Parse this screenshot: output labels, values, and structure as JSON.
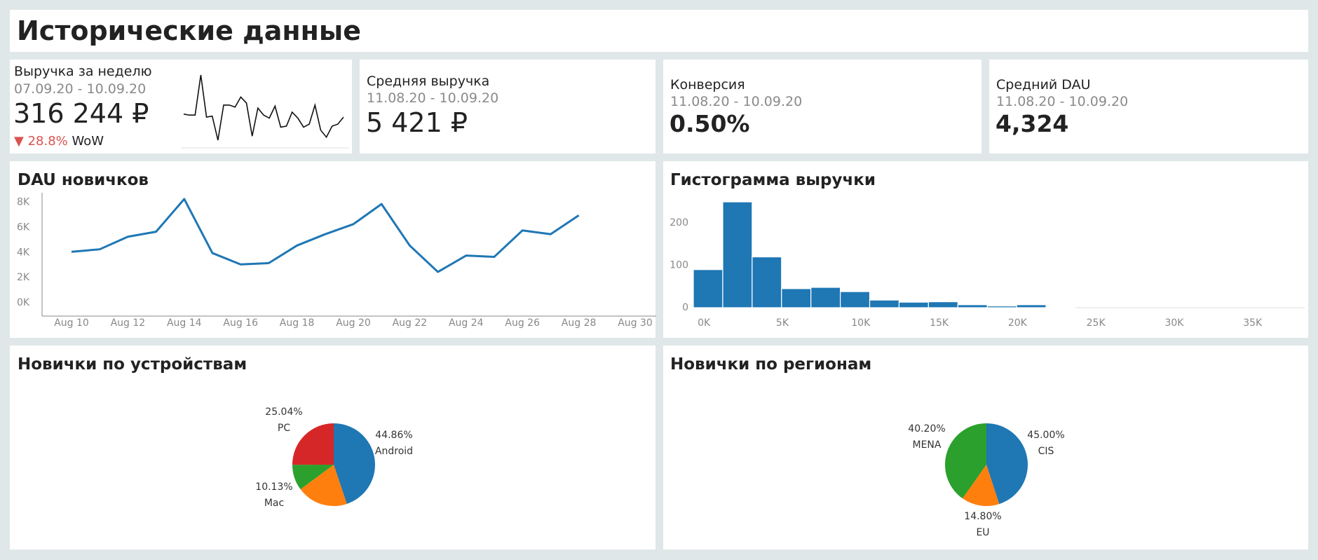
{
  "header": {
    "title": "Исторические данные"
  },
  "kpis": {
    "weekly_revenue": {
      "title": "Выручка за неделю",
      "period": "07.09.20 - 10.09.20",
      "value": "316 244 ₽",
      "change_arrow": "▼",
      "change": "28.8%",
      "change_suffix": "WoW",
      "change_color": "#d9534f",
      "sparkline": [
        61,
        60,
        60,
        100,
        58,
        59,
        35,
        70,
        70,
        68,
        78,
        72,
        39,
        67,
        60,
        57,
        69,
        48,
        49,
        63,
        57,
        48,
        51,
        70,
        45,
        38,
        49,
        51,
        58
      ]
    },
    "avg_revenue": {
      "title": "Средняя выручка",
      "period": "11.08.20 - 10.09.20",
      "value": "5 421 ₽"
    },
    "conversion": {
      "title": "Конверсия",
      "period": "11.08.20 - 10.09.20",
      "value": "0.50%"
    },
    "avg_dau": {
      "title": "Средний DAU",
      "period": "11.08.20 - 10.09.20",
      "value": "4,324"
    }
  },
  "panels": {
    "dau_new": {
      "title": "DAU новичков"
    },
    "revenue_hist": {
      "title": "Гистограмма выручки"
    },
    "devices": {
      "title": "Новички по устройствам"
    },
    "regions": {
      "title": "Новички по регионам"
    }
  },
  "colors": {
    "blue": "#1f77b4",
    "orange": "#ff7f0e",
    "green": "#2ca02c",
    "red": "#d62728",
    "axis": "#888888"
  },
  "chart_data": [
    {
      "type": "line",
      "title": "DAU новичков",
      "x": [
        "Aug 10",
        "Aug 11",
        "Aug 12",
        "Aug 13",
        "Aug 14",
        "Aug 15",
        "Aug 16",
        "Aug 17",
        "Aug 18",
        "Aug 19",
        "Aug 20",
        "Aug 21",
        "Aug 22",
        "Aug 23",
        "Aug 24",
        "Aug 25",
        "Aug 26",
        "Aug 27",
        "Aug 28",
        "Aug 29",
        "Aug 30"
      ],
      "values": [
        4000,
        4200,
        5200,
        5600,
        8200,
        3900,
        3000,
        3100,
        4500,
        5400,
        6200,
        7800,
        4500,
        2400,
        3700,
        3600,
        5700,
        5400,
        6900
      ],
      "x_ticks": [
        "Aug 10",
        "Aug 12",
        "Aug 14",
        "Aug 16",
        "Aug 18",
        "Aug 20",
        "Aug 22",
        "Aug 24",
        "Aug 26",
        "Aug 28",
        "Aug 30"
      ],
      "y_ticks": [
        "0K",
        "2K",
        "4K",
        "6K",
        "8K"
      ],
      "ylim": [
        0,
        8700
      ],
      "grid": false
    },
    {
      "type": "bar",
      "title": "Гистограмма выручки",
      "bin_width": 1875,
      "bin_start": -500,
      "values": [
        90,
        250,
        120,
        45,
        48,
        38,
        18,
        13,
        14,
        7,
        4,
        7,
        2
      ],
      "x_ticks": [
        "0K",
        "5K",
        "10K",
        "15K",
        "20K",
        "25K",
        "30K",
        "35K"
      ],
      "x_tick_values": [
        0,
        5000,
        10000,
        15000,
        20000,
        25000,
        30000,
        35000
      ],
      "xlim": [
        -500,
        38500
      ],
      "y_ticks": [
        "0",
        "100",
        "200"
      ],
      "y_tick_values": [
        0,
        100,
        200
      ],
      "ylim": [
        0,
        260
      ],
      "grid": false
    },
    {
      "type": "pie",
      "title": "Новички по устройствам",
      "slices": [
        {
          "label": "Android",
          "pct": "44.86%",
          "value": 44.86,
          "color": "#1f77b4"
        },
        {
          "label": "",
          "pct": "",
          "value": 19.97,
          "color": "#ff7f0e"
        },
        {
          "label": "Mac",
          "pct": "10.13%",
          "value": 10.13,
          "color": "#2ca02c"
        },
        {
          "label": "PC",
          "pct": "25.04%",
          "value": 25.04,
          "color": "#d62728"
        }
      ]
    },
    {
      "type": "pie",
      "title": "Новички по регионам",
      "slices": [
        {
          "label": "CIS",
          "pct": "45.00%",
          "value": 45.0,
          "color": "#1f77b4"
        },
        {
          "label": "EU",
          "pct": "14.80%",
          "value": 14.8,
          "color": "#ff7f0e"
        },
        {
          "label": "MENA",
          "pct": "40.20%",
          "value": 40.2,
          "color": "#2ca02c"
        }
      ]
    }
  ]
}
